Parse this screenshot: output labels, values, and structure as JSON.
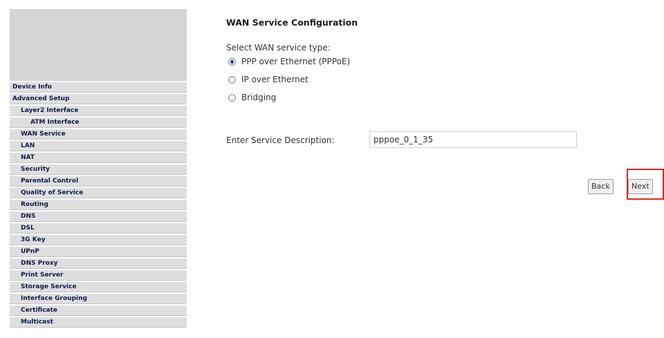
{
  "sidebar": {
    "items": [
      {
        "label": "Device Info",
        "level": 0
      },
      {
        "label": "Advanced Setup",
        "level": 0
      },
      {
        "label": "Layer2 Interface",
        "level": 1
      },
      {
        "label": "ATM Interface",
        "level": 2
      },
      {
        "label": "WAN Service",
        "level": 1
      },
      {
        "label": "LAN",
        "level": 1
      },
      {
        "label": "NAT",
        "level": 1
      },
      {
        "label": "Security",
        "level": 1
      },
      {
        "label": "Parental Control",
        "level": 1
      },
      {
        "label": "Quality of Service",
        "level": 1
      },
      {
        "label": "Routing",
        "level": 1
      },
      {
        "label": "DNS",
        "level": 1
      },
      {
        "label": "DSL",
        "level": 1
      },
      {
        "label": "3G Key",
        "level": 1
      },
      {
        "label": "UPnP",
        "level": 1
      },
      {
        "label": "DNS Proxy",
        "level": 1
      },
      {
        "label": "Print Server",
        "level": 1
      },
      {
        "label": "Storage Service",
        "level": 1
      },
      {
        "label": "Interface Grouping",
        "level": 1
      },
      {
        "label": "Certificate",
        "level": 1
      },
      {
        "label": "Multicast",
        "level": 1
      }
    ]
  },
  "main": {
    "title": "WAN Service Configuration",
    "prompt": "Select WAN service type:",
    "options": [
      {
        "label": "PPP over Ethernet (PPPoE)",
        "checked": true
      },
      {
        "label": "IP over Ethernet",
        "checked": false
      },
      {
        "label": "Bridging",
        "checked": false
      }
    ],
    "description_label": "Enter Service Description:",
    "description_value": "pppoe_0_1_35",
    "back_label": "Back",
    "next_label": "Next"
  },
  "colors": {
    "highlight": "#e02424",
    "menu_bg": "#dedede",
    "menu_text": "#0e1a4a"
  }
}
